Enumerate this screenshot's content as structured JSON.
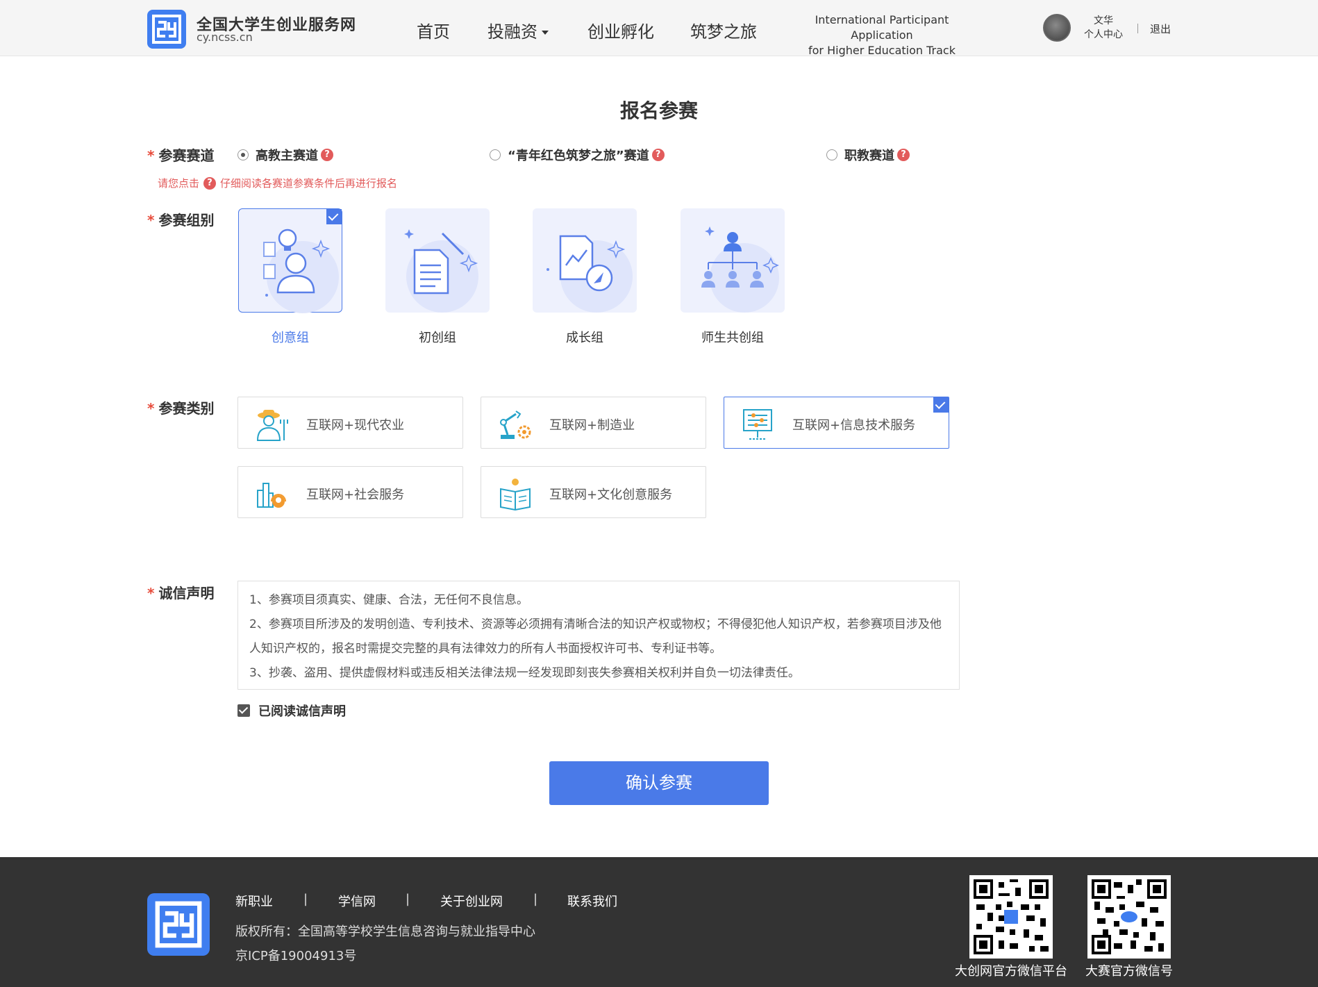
{
  "header": {
    "site_title": "全国大学生创业服务网",
    "site_url": "cy.ncss.cn",
    "nav": [
      {
        "label": "首页"
      },
      {
        "label": "投融资"
      },
      {
        "label": "创业孵化"
      },
      {
        "label": "筑梦之旅"
      }
    ],
    "intl_line1": "International Participant Application",
    "intl_line2": "for Higher Education Track",
    "user_name": "文华",
    "user_center": "个人中心",
    "logout": "退出"
  },
  "form": {
    "title": "报名参赛",
    "track_label": "参赛赛道",
    "track_options": [
      {
        "label": "高教主赛道",
        "checked": true
      },
      {
        "label": "“青年红色筑梦之旅”赛道",
        "checked": false
      },
      {
        "label": "职教赛道",
        "checked": false
      }
    ],
    "hint_prefix": "请您点击",
    "hint_suffix": "仔细阅读各赛道参赛条件后再进行报名",
    "help_mark": "?",
    "group_label": "参赛组别",
    "groups": [
      {
        "label": "创意组",
        "selected": true
      },
      {
        "label": "初创组",
        "selected": false
      },
      {
        "label": "成长组",
        "selected": false
      },
      {
        "label": "师生共创组",
        "selected": false
      }
    ],
    "category_label": "参赛类别",
    "categories": [
      {
        "label": "互联网+现代农业",
        "selected": false
      },
      {
        "label": "互联网+制造业",
        "selected": false
      },
      {
        "label": "互联网+信息技术服务",
        "selected": true
      },
      {
        "label": "互联网+社会服务",
        "selected": false
      },
      {
        "label": "互联网+文化创意服务",
        "selected": false
      }
    ],
    "declaration_label": "诚信声明",
    "declaration": [
      "1、参赛项目须真实、健康、合法，无任何不良信息。",
      "2、参赛项目所涉及的发明创造、专利技术、资源等必须拥有清晰合法的知识产权或物权；不得侵犯他人知识产权，若参赛项目涉及他人知识产权的，报名时需提交完整的具有法律效力的所有人书面授权许可书、专利证书等。",
      "3、抄袭、盗用、提供虚假材料或违反相关法律法规一经发现即刻丧失参赛相关权利并自负一切法律责任。"
    ],
    "agree_label": "已阅读诚信声明",
    "agree_checked": true,
    "confirm_button": "确认参赛"
  },
  "footer": {
    "links": [
      "新职业",
      "学信网",
      "关于创业网",
      "联系我们"
    ],
    "separator": "|",
    "copyright": "版权所有：全国高等学校学生信息咨询与就业指导中心",
    "icp": "京ICP备19004913号",
    "qr_labels": [
      "大创网官方微信平台",
      "大赛官方微信号"
    ]
  },
  "colors": {
    "accent": "#4a7ae8",
    "required": "#e74c3c",
    "footer_bg": "#333333"
  }
}
